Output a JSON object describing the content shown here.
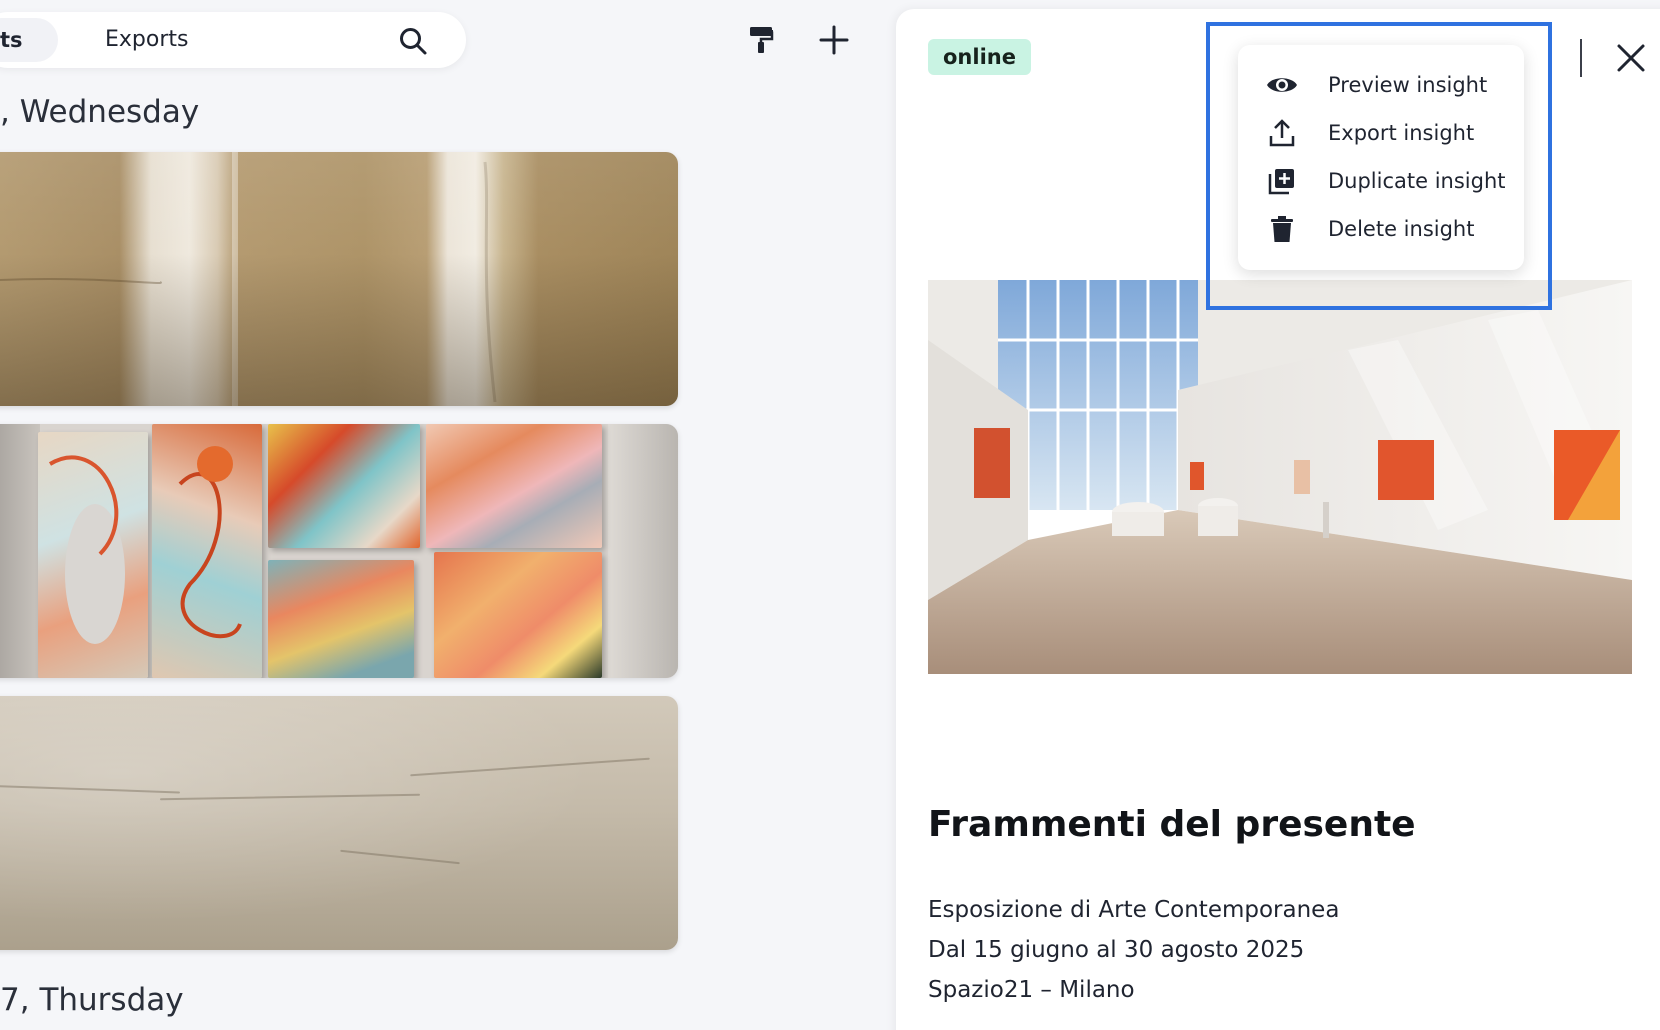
{
  "header": {
    "tab_partial_label": "ts",
    "exports_label": "Exports",
    "icons": [
      "search-icon",
      "paint-roller-icon",
      "plus-icon"
    ]
  },
  "feed": {
    "day_1": {
      "prefix": ", ",
      "day": "Wednesday"
    },
    "day_2": {
      "prefix": "7, ",
      "day": "Thursday"
    },
    "cards": [
      {
        "name": "textured-wall-panels"
      },
      {
        "name": "colorful-canvases"
      },
      {
        "name": "plaster-wall"
      }
    ]
  },
  "panel": {
    "status": "online",
    "title": "Frammenti del presente",
    "lines": [
      "Esposizione di Arte Contemporanea",
      "Dal 15 giugno al 30 agosto 2025",
      "Spazio21 – Milano"
    ]
  },
  "menu": {
    "items": [
      {
        "label": "Preview insight",
        "icon": "eye-icon"
      },
      {
        "label": "Export insight",
        "icon": "upload-icon"
      },
      {
        "label": "Duplicate insight",
        "icon": "duplicate-icon"
      },
      {
        "label": "Delete insight",
        "icon": "trash-icon"
      }
    ]
  },
  "colors": {
    "status_badge_bg": "#c9f3e3",
    "highlight_border": "#2f72e0",
    "page_bg": "#f5f6f9"
  }
}
